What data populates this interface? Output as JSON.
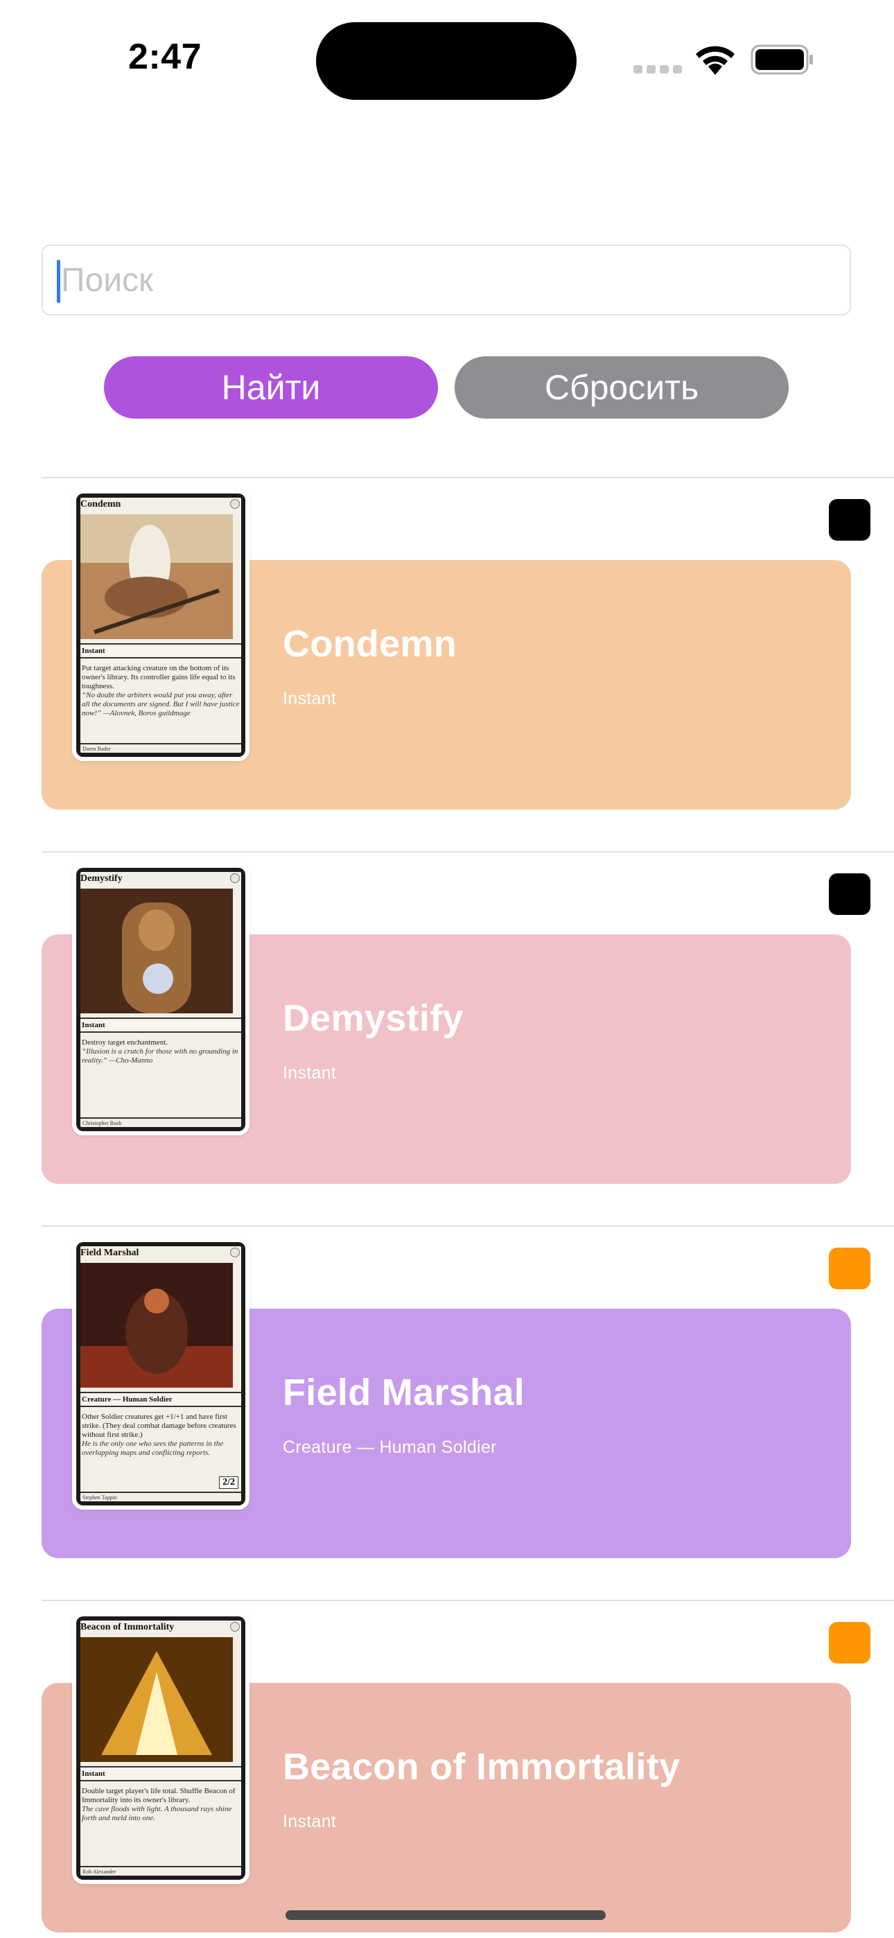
{
  "status_bar": {
    "time": "2:47"
  },
  "search": {
    "placeholder": "Поиск",
    "value": ""
  },
  "buttons": {
    "find": "Найти",
    "reset": "Сбросить"
  },
  "cards": [
    {
      "name": "Condemn",
      "type": "Instant",
      "bg_color": "#f6caa0",
      "marker_color": "#000000",
      "art": {
        "title": "Condemn",
        "type_line": "Instant",
        "rules_text": "Put target attacking creature on the bottom of its owner's library. Its controller gains life equal to its toughness.",
        "flavor_text": "“No doubt the arbiters would put you away, after all the documents are signed. But I will have justice now!” —Alovnek, Boros guildmage",
        "artist": "Daren Bader",
        "art_colors": [
          "#b9875a",
          "#e8dcc6",
          "#5b4330"
        ]
      }
    },
    {
      "name": "Demystify",
      "type": "Instant",
      "bg_color": "#f1c1c8",
      "marker_color": "#000000",
      "art": {
        "title": "Demystify",
        "type_line": "Instant",
        "rules_text": "Destroy target enchantment.",
        "flavor_text": "“Illusion is a crutch for those with no grounding in reality.” —Cho-Manno",
        "artist": "Christopher Rush",
        "art_colors": [
          "#4a2a18",
          "#9c6a3a",
          "#cfd8e8"
        ]
      }
    },
    {
      "name": "Field Marshal",
      "type": "Creature — Human Soldier",
      "bg_color": "#c79bec",
      "marker_color": "#ff9500",
      "art": {
        "title": "Field Marshal",
        "type_line": "Creature — Human Soldier",
        "rules_text": "Other Soldier creatures get +1/+1 and have first strike. (They deal combat damage before creatures without first strike.)",
        "flavor_text": "He is the only one who sees the patterns in the overlapping maps and conflicting reports.",
        "artist": "Stephen Tappin",
        "power_toughness": "2/2",
        "art_colors": [
          "#3a1a12",
          "#8a2e1c",
          "#c46a3a"
        ]
      }
    },
    {
      "name": "Beacon of Immortality",
      "type": "Instant",
      "bg_color": "#ebb8ab",
      "marker_color": "#ff9500",
      "art": {
        "title": "Beacon of Immortality",
        "type_line": "Instant",
        "rules_text": "Double target player's life total. Shuffle Beacon of Immortality into its owner's library.",
        "flavor_text": "The cave floods with light. A thousand rays shine forth and meld into one.",
        "artist": "Rob Alexander",
        "art_colors": [
          "#5a3208",
          "#e0a030",
          "#fff4c0"
        ]
      }
    }
  ]
}
